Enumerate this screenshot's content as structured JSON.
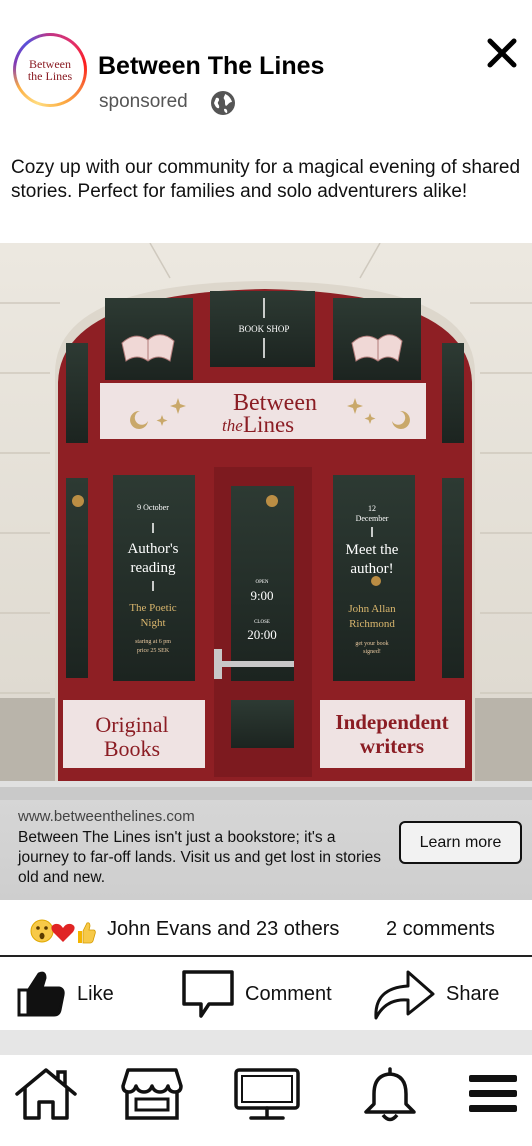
{
  "post": {
    "page_name": "Between The Lines",
    "sponsored_label": "sponsored",
    "avatar_line1": "Between",
    "avatar_line2": "the Lines",
    "caption": "Cozy up with our community for a magical evening of shared stories. Perfect for families and solo adventurers alike!"
  },
  "hero": {
    "sign_book_shop": "BOOK SHOP",
    "sign_between": "Between",
    "sign_the": "the",
    "sign_lines": "Lines",
    "left_window": {
      "date": "9 October",
      "title1": "Author's",
      "title2": "reading",
      "sub1": "The Poetic",
      "sub2": "Night",
      "small1": "staring at 6 pm",
      "small2": "price 25 SEK"
    },
    "door": {
      "open_label": "OPEN",
      "open_time": "9:00",
      "close_label": "CLOSE",
      "close_time": "20:00"
    },
    "right_window": {
      "date1": "12",
      "date2": "December",
      "title1": "Meet the",
      "title2": "author!",
      "sub1": "John Allan",
      "sub2": "Richmond",
      "small1": "get your book",
      "small2": "signed!"
    },
    "panel_left1": "Original",
    "panel_left2": "Books",
    "panel_right1": "Independent",
    "panel_right2": "writers"
  },
  "link": {
    "url": "www.betweenthelines.com",
    "description": "Between The Lines isn't just a bookstore; it's a journey to far-off lands. Visit us and get lost in stories old and new.",
    "cta": "Learn more"
  },
  "reactions": {
    "names": "John Evans and 23 others",
    "comments": "2 comments"
  },
  "actions": {
    "like": "Like",
    "comment": "Comment",
    "share": "Share"
  },
  "colors": {
    "door_red": "#8e1f24",
    "sign_text": "#8b1d24",
    "gold": "#c9a86a"
  },
  "icons": [
    "globe-icon",
    "close-icon",
    "like-icon",
    "comment-icon",
    "share-icon",
    "home-icon",
    "marketplace-icon",
    "watch-icon",
    "notifications-icon",
    "menu-icon"
  ]
}
